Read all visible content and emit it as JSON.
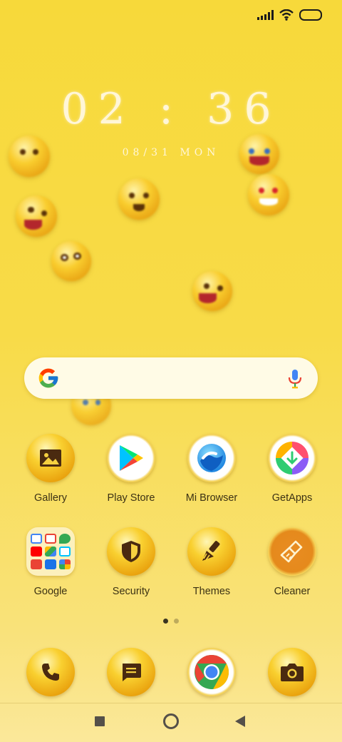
{
  "status_bar": {
    "signal_icon": "signal-icon",
    "wifi_icon": "wifi-icon",
    "battery_icon": "battery-icon"
  },
  "lock": {
    "time": "02 : 36",
    "date": "08/31 MON"
  },
  "search": {
    "logo": "google-g-icon",
    "mic": "mic-icon"
  },
  "apps_row1": [
    {
      "label": "Gallery",
      "icon": "gallery-icon"
    },
    {
      "label": "Play Store",
      "icon": "play-store-icon"
    },
    {
      "label": "Mi Browser",
      "icon": "mi-browser-icon"
    },
    {
      "label": "GetApps",
      "icon": "getapps-icon"
    }
  ],
  "apps_row2": [
    {
      "label": "Google",
      "icon": "google-folder-icon"
    },
    {
      "label": "Security",
      "icon": "security-shield-icon"
    },
    {
      "label": "Themes",
      "icon": "themes-brush-icon"
    },
    {
      "label": "Cleaner",
      "icon": "cleaner-brush-icon"
    }
  ],
  "pager": {
    "pages": 2,
    "current": 1
  },
  "dock": [
    {
      "icon": "phone-icon"
    },
    {
      "icon": "messages-icon"
    },
    {
      "icon": "chrome-icon"
    },
    {
      "icon": "camera-icon"
    }
  ],
  "nav": {
    "recents": "recents-square-icon",
    "home": "home-circle-icon",
    "back": "back-triangle-icon"
  },
  "colors": {
    "accent": "#f7d93a",
    "icon_glyph": "#4a2a10"
  }
}
